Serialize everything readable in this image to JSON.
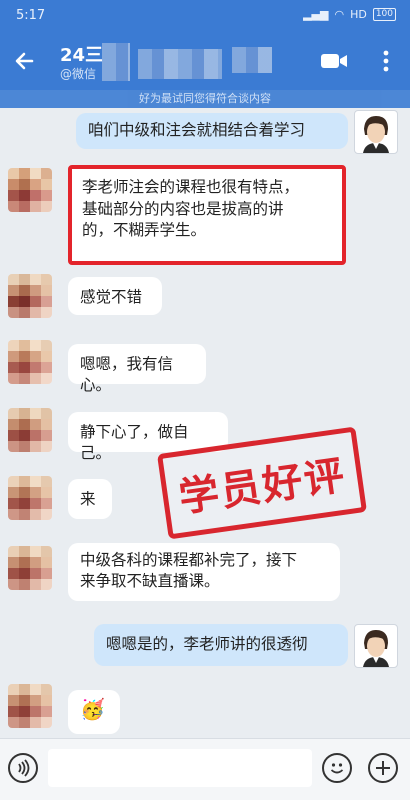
{
  "status": {
    "time": "5:17",
    "signal_text": "HD",
    "battery": "100"
  },
  "header": {
    "title": "24三",
    "subtitle": "@微信",
    "banner": "好为最试同您得符合谈内容"
  },
  "messages": [
    {
      "side": "me",
      "text": "咱们中级和注会就相结合着学习"
    },
    {
      "side": "them",
      "text": "李老师注会的课程也很有特点，基础部分的内容也是拔高的讲的，不糊弄学生。",
      "lines": [
        "李老师注会的课程也很有特点，",
        "基础部分的内容也是拔高的讲",
        "的，不糊弄学生。"
      ]
    },
    {
      "side": "them",
      "text": "感觉不错"
    },
    {
      "side": "them",
      "text": "嗯嗯，我有信心。"
    },
    {
      "side": "them",
      "text": "静下心了，做自己。"
    },
    {
      "side": "them",
      "text": "来"
    },
    {
      "side": "them",
      "text": "中级各科的课程都补完了，接下来争取不缺直播课。",
      "lines": [
        "中级各科的课程都补完了，接下",
        "来争取不缺直播课。"
      ]
    },
    {
      "side": "me",
      "text": "嗯嗯是的，李老师讲的很透彻"
    },
    {
      "side": "them",
      "text": "🥳"
    }
  ],
  "stamp": {
    "text": "学员好评"
  },
  "colors": {
    "header": "#3b7bd3",
    "bubble_me": "#cfe6fb",
    "stamp": "#d8262e"
  }
}
